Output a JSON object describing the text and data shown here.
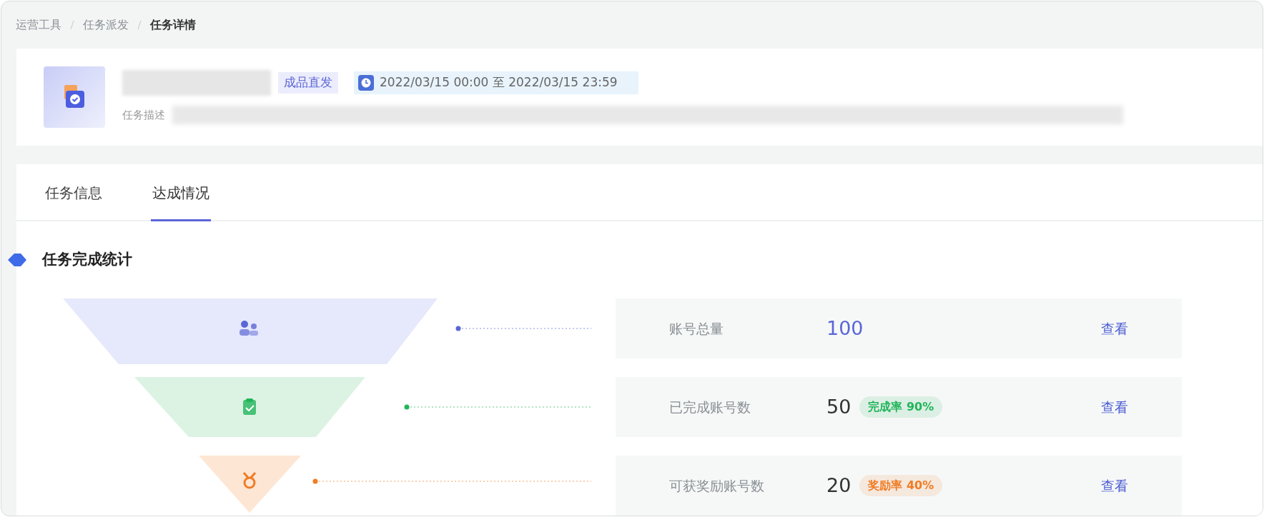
{
  "breadcrumb": [
    {
      "label": "运营工具",
      "current": false
    },
    {
      "label": "任务派发",
      "current": false
    },
    {
      "label": "任务详情",
      "current": true
    }
  ],
  "task": {
    "tag": "成品直发",
    "time_range": "2022/03/15 00:00 至 2022/03/15 23:59",
    "description_label": "任务描述"
  },
  "tabs": [
    {
      "label": "任务信息",
      "selected": false
    },
    {
      "label": "达成情况",
      "selected": true
    }
  ],
  "section_title": "任务完成统计",
  "funnel": [
    {
      "kind": "total",
      "label": "账号总量",
      "value": "100",
      "color": "#5b66d6",
      "action": "查看"
    },
    {
      "kind": "completed",
      "label": "已完成账号数",
      "value": "50",
      "badge": "完成率 90%",
      "color": "#22b55a",
      "action": "查看"
    },
    {
      "kind": "rewarded",
      "label": "可获奖励账号数",
      "value": "20",
      "badge": "奖励率 40%",
      "color": "#f07c24",
      "action": "查看"
    }
  ]
}
